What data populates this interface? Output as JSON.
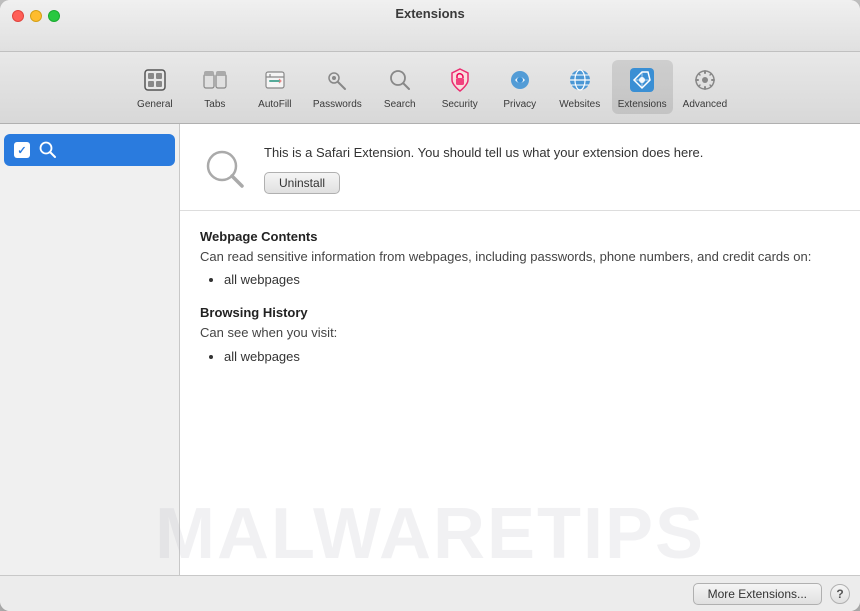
{
  "window": {
    "title": "Extensions"
  },
  "toolbar": {
    "items": [
      {
        "id": "general",
        "label": "General",
        "icon": "general"
      },
      {
        "id": "tabs",
        "label": "Tabs",
        "icon": "tabs"
      },
      {
        "id": "autofill",
        "label": "AutoFill",
        "icon": "autofill"
      },
      {
        "id": "passwords",
        "label": "Passwords",
        "icon": "passwords"
      },
      {
        "id": "search",
        "label": "Search",
        "icon": "search"
      },
      {
        "id": "security",
        "label": "Security",
        "icon": "security"
      },
      {
        "id": "privacy",
        "label": "Privacy",
        "icon": "privacy"
      },
      {
        "id": "websites",
        "label": "Websites",
        "icon": "websites"
      },
      {
        "id": "extensions",
        "label": "Extensions",
        "icon": "extensions",
        "active": true
      },
      {
        "id": "advanced",
        "label": "Advanced",
        "icon": "advanced"
      }
    ]
  },
  "sidebar": {
    "items": [
      {
        "id": "search-ext",
        "label": "Search",
        "checked": true,
        "selected": true
      }
    ]
  },
  "detail": {
    "extension_description": "This is a Safari Extension. You should tell us what your extension does here.",
    "uninstall_label": "Uninstall",
    "sections": [
      {
        "title": "Webpage Contents",
        "description": "Can read sensitive information from webpages, including passwords, phone numbers, and credit cards on:",
        "items": [
          "all webpages"
        ]
      },
      {
        "title": "Browsing History",
        "description": "Can see when you visit:",
        "items": [
          "all webpages"
        ]
      }
    ]
  },
  "footer": {
    "more_extensions_label": "More Extensions...",
    "help_label": "?"
  },
  "watermark": {
    "text": "MALWARETIPS"
  }
}
